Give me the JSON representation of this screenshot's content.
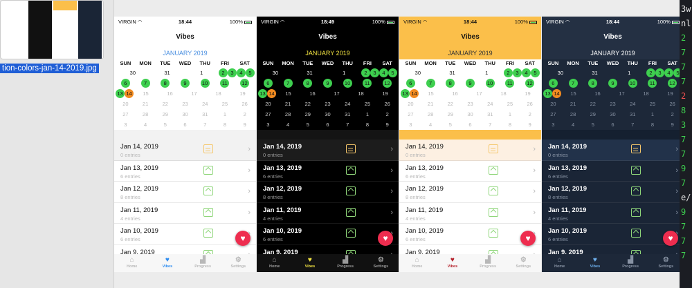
{
  "finder": {
    "file_name": "tion-colors-jan-14-2019.jpg"
  },
  "terminal": {
    "lines": [
      "3w",
      "nl",
      "2",
      "7",
      "7",
      "7",
      "2",
      "8",
      "3",
      "7",
      "7",
      "9",
      "7",
      "e/",
      "9",
      "7",
      "7",
      "7"
    ]
  },
  "app": {
    "nav_title": "Vibes",
    "month_label": "JANUARY 2019",
    "days_of_week": [
      "SUN",
      "MON",
      "TUE",
      "WED",
      "THU",
      "FRI",
      "SAT"
    ],
    "weeks": [
      [
        {
          "d": "30",
          "m": "p"
        },
        {
          "d": "31",
          "m": "p"
        },
        {
          "d": "1",
          "m": "n"
        },
        {
          "d": "2",
          "m": "g"
        },
        {
          "d": "3",
          "m": "g"
        },
        {
          "d": "4",
          "m": "g"
        },
        {
          "d": "5",
          "m": "g"
        }
      ],
      [
        {
          "d": "6",
          "m": "g"
        },
        {
          "d": "7",
          "m": "g"
        },
        {
          "d": "8",
          "m": "g"
        },
        {
          "d": "9",
          "m": "g"
        },
        {
          "d": "10",
          "m": "g"
        },
        {
          "d": "11",
          "m": "g"
        },
        {
          "d": "12",
          "m": "g"
        }
      ],
      [
        {
          "d": "13",
          "m": "g"
        },
        {
          "d": "14",
          "m": "o"
        },
        {
          "d": "15",
          "m": "f"
        },
        {
          "d": "16",
          "m": "f"
        },
        {
          "d": "17",
          "m": "f"
        },
        {
          "d": "18",
          "m": "f"
        },
        {
          "d": "19",
          "m": "f"
        }
      ],
      [
        {
          "d": "20",
          "m": "f"
        },
        {
          "d": "21",
          "m": "f"
        },
        {
          "d": "22",
          "m": "f"
        },
        {
          "d": "23",
          "m": "f"
        },
        {
          "d": "24",
          "m": "f"
        },
        {
          "d": "25",
          "m": "f"
        },
        {
          "d": "26",
          "m": "f"
        }
      ],
      [
        {
          "d": "27",
          "m": "f"
        },
        {
          "d": "28",
          "m": "f"
        },
        {
          "d": "29",
          "m": "f"
        },
        {
          "d": "30",
          "m": "f"
        },
        {
          "d": "31",
          "m": "f"
        },
        {
          "d": "1",
          "m": "f"
        },
        {
          "d": "2",
          "m": "f"
        }
      ],
      [
        {
          "d": "3",
          "m": "f"
        },
        {
          "d": "4",
          "m": "f"
        },
        {
          "d": "5",
          "m": "f"
        },
        {
          "d": "6",
          "m": "f"
        },
        {
          "d": "7",
          "m": "f"
        },
        {
          "d": "8",
          "m": "f"
        },
        {
          "d": "9",
          "m": "f"
        }
      ]
    ],
    "entries": [
      {
        "date": "Jan 14, 2019",
        "count": "0 entries",
        "icon": "equal-box-icon"
      },
      {
        "date": "Jan 13, 2019",
        "count": "6 entries",
        "icon": "up-arrow-box-icon"
      },
      {
        "date": "Jan 12, 2019",
        "count": "8 entries",
        "icon": "up-arrow-box-icon"
      },
      {
        "date": "Jan 11, 2019",
        "count": "4 entries",
        "icon": "up-arrow-box-icon"
      },
      {
        "date": "Jan 10, 2019",
        "count": "6 entries",
        "icon": "up-arrow-box-icon"
      },
      {
        "date": "Jan 9, 2019",
        "count": "",
        "icon": "up-arrow-box-icon"
      }
    ],
    "tabs": [
      "Home",
      "Vibes",
      "Progress",
      "Settings"
    ],
    "chevron": "›",
    "fab_icon": "♥"
  },
  "screens": [
    {
      "theme": "light",
      "carrier": "VIRGIN",
      "time": "18:44",
      "battery": "100%",
      "bg": "#ffffff",
      "fg": "#111111",
      "muted": "#b8b8b8",
      "month_color": "#4a8fe0",
      "header_bg": "#ffffff",
      "list_bg": "#ffffff",
      "selected_bg": "#f2f2f2",
      "divider_bg": "#f2f2f2",
      "tab_bg": "#f7f7f7",
      "tab_active": "#2d8cf0",
      "eq_color": "#f5c76b",
      "up_color": "#8fd67a",
      "status_fg": "#111111"
    },
    {
      "theme": "dark",
      "carrier": "VIRGIN",
      "time": "18:49",
      "battery": "100%",
      "bg": "#000000",
      "fg": "#ffffff",
      "muted": "#9a9a9a",
      "month_color": "#f5e642",
      "header_bg": "#000000",
      "list_bg": "#000000",
      "selected_bg": "#1c1c1c",
      "divider_bg": "#141414",
      "tab_bg": "#111111",
      "tab_active": "#f5e642",
      "eq_color": "#f5c76b",
      "up_color": "#8fd67a",
      "status_fg": "#ffffff"
    },
    {
      "theme": "peach",
      "carrier": "VIRGIN",
      "time": "18:44",
      "battery": "100%",
      "bg": "#ffffff",
      "fg": "#111111",
      "muted": "#b8b8b8",
      "month_color": "#333333",
      "header_bg": "#fbbf4a",
      "list_bg": "#ffffff",
      "selected_bg": "#fdf0e2",
      "divider_bg": "#fbbf4a",
      "tab_bg": "#f7f7f7",
      "tab_active": "#b5202a",
      "eq_color": "#f5c76b",
      "up_color": "#8fd67a",
      "status_fg": "#111111"
    },
    {
      "theme": "navy",
      "carrier": "VIRGIN",
      "time": "18:44",
      "battery": "100%",
      "bg": "#1a2536",
      "fg": "#ffffff",
      "muted": "#8792a3",
      "month_color": "#ffffff",
      "header_bg": "#243043",
      "list_bg": "#1a2536",
      "selected_bg": "#22324a",
      "divider_bg": "#152030",
      "tab_bg": "#1d2839",
      "tab_active": "#6fb2f0",
      "eq_color": "#f5c76b",
      "up_color": "#8fd67a",
      "status_fg": "#ffffff"
    }
  ]
}
